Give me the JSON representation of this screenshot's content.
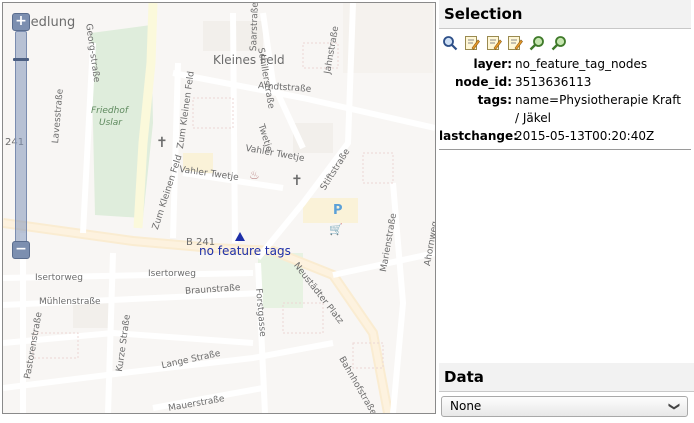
{
  "map": {
    "labels": {
      "siedlung": "l Siedlung",
      "kleines_feld": "Kleines Feld",
      "arndtstrasse": "Arndtstraße",
      "jahnstrasse": "Jahnstraße",
      "schillerstrasse": "Schillerstraße",
      "saarstrasse": "Saarstraße",
      "georgstrasse": "Georg-straße",
      "lavesstrasse": "Lavesstraße",
      "friedhof": "Friedhof",
      "uslar": "Uslar",
      "zum_kleinen_feld_1": "Zum Kleinen Feld",
      "zum_kleinen_feld_2": "Zum Kleinen Feld",
      "vahler_twetje_1": "Vahler Twetje",
      "vahler_twetje_2": "Vahler Twetje",
      "twetje": "Twetje",
      "stiftstrasse": "Stiftstraße",
      "b241_left": "241",
      "b241_mid": "B 241",
      "isertorweg_1": "Isertorweg",
      "isertorweg_2": "Isertorweg",
      "braunstrasse": "Braunstraße",
      "muehlenstrasse": "Mühlenstraße",
      "forstgasse": "Forstgasse",
      "neustaedter_platz": "Neustädter Platz",
      "marienstrasse": "Marienstraße",
      "ahornweg": "Ahornweg",
      "kurze_strasse": "Kurze Straße",
      "lange_strasse": "Lange Straße",
      "pastorenstrasse": "Pastorenstraße",
      "mauerstrasse": "Mauerstraße",
      "bahnhofstrasse": "Bahnhofstraße",
      "parking": "P"
    },
    "marker_label": "no feature tags",
    "zoom_in_symbol": "+",
    "zoom_out_symbol": "−"
  },
  "selection": {
    "title": "Selection",
    "tools": [
      "zoom-icon",
      "edit-icon",
      "edit-icon",
      "edit-icon",
      "search-zoom-icon",
      "search-zoom-icon"
    ],
    "attributes": [
      {
        "key": "layer:",
        "value": "no_feature_tag_nodes"
      },
      {
        "key": "node_id:",
        "value": "3513636113"
      },
      {
        "key": "tags:",
        "value": "name=Physiotherapie Kraft / Jäkel"
      },
      {
        "key": "lastchange:",
        "value": "2015-05-13T00:20:40Z"
      }
    ]
  },
  "data": {
    "title": "Data",
    "select_value": "None"
  }
}
